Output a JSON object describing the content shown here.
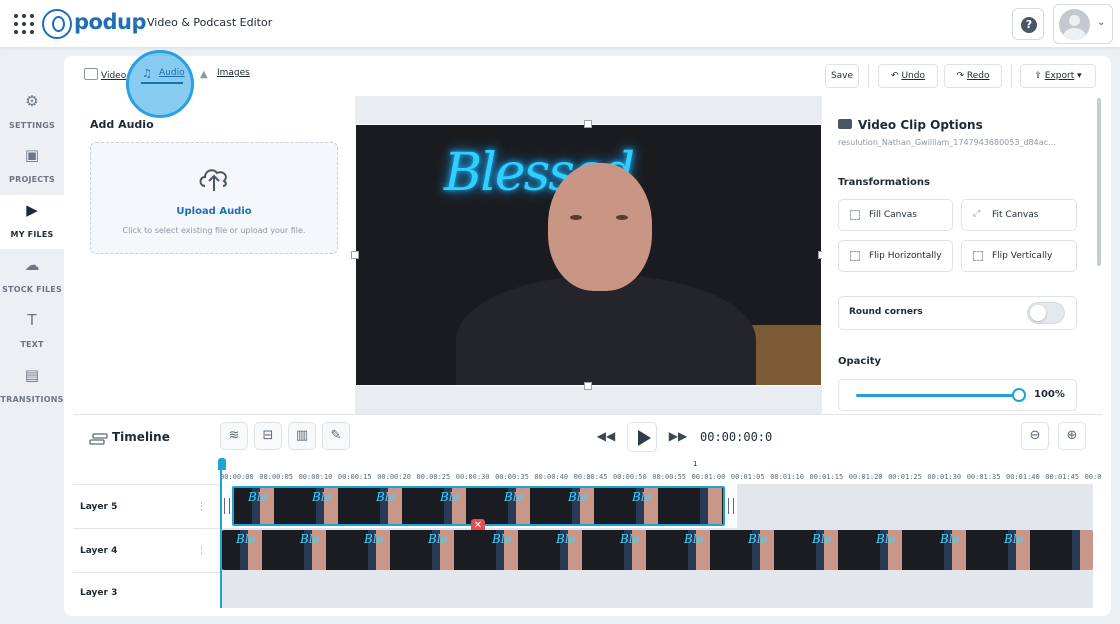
{
  "header": {
    "logo_text": "podup",
    "breadcrumb": "Video & Podcast Editor",
    "help_label": "?"
  },
  "sidebar": {
    "items": [
      {
        "label": "SETTINGS",
        "icon": "gear-icon",
        "glyph": "⚙"
      },
      {
        "label": "PROJECTS",
        "icon": "projects-icon",
        "glyph": "▣"
      },
      {
        "label": "MY FILES",
        "icon": "my-files-icon",
        "glyph": "▶"
      },
      {
        "label": "STOCK FILES",
        "icon": "cloud-icon",
        "glyph": "☁"
      },
      {
        "label": "TEXT",
        "icon": "text-icon",
        "glyph": "T"
      },
      {
        "label": "TRANSITIONS",
        "icon": "transitions-icon",
        "glyph": "▤"
      }
    ],
    "active": "MY FILES"
  },
  "media_tabs": [
    {
      "label": "Video"
    },
    {
      "label": "Audio"
    },
    {
      "label": "Images"
    }
  ],
  "toolbar": {
    "save": "Save",
    "undo": "Undo",
    "redo": "Redo",
    "export": "Export"
  },
  "audio_panel": {
    "title": "Add Audio",
    "upload_title": "Upload Audio",
    "upload_sub": "Click to select existing file or upload your file."
  },
  "preview": {
    "neon_text": "Blessed"
  },
  "clip_options": {
    "title": "Video Clip Options",
    "filename": "resulution_Nathan_Gwilliam_1747943680053_d84ac...",
    "transformations_label": "Transformations",
    "buttons": [
      "Fill Canvas",
      "Fit Canvas",
      "Flip Horizontally",
      "Flip Vertically"
    ],
    "round_corners_label": "Round corners",
    "round_corners_on": false,
    "opacity_label": "Opacity",
    "opacity_value": "100%",
    "opacity_fraction": 1.0
  },
  "timeline": {
    "title": "Timeline",
    "timecode": "00:00:00:0",
    "ruler_marker": "1",
    "ticks": [
      "00:00:00",
      "00:00:05",
      "00:00:10",
      "00:00:15",
      "00:00:20",
      "00:00:25",
      "00:00:30",
      "00:00:35",
      "00:00:40",
      "00:00:45",
      "00:00:50",
      "00:00:55",
      "00:01:00",
      "00:01:05",
      "00:01:10",
      "00:01:15",
      "00:01:20",
      "00:01:25",
      "00:01:30",
      "00:01:35",
      "00:01:40",
      "00:01:45",
      "00:0"
    ],
    "layers": [
      "Layer 5",
      "Layer 4",
      "Layer 3"
    ],
    "delete_glyph": "✕"
  },
  "colors": {
    "accent": "#1fa3d6",
    "brand": "#1e6fb3",
    "highlight": "#48afe8"
  }
}
